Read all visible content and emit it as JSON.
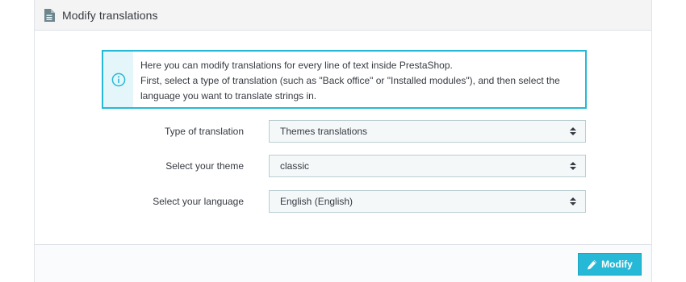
{
  "panel": {
    "title": "Modify translations",
    "title_icon": "document-icon"
  },
  "info": {
    "icon": "info-circle-icon",
    "line1": "Here you can modify translations for every line of text inside PrestaShop.",
    "line2": "First, select a type of translation (such as \"Back office\" or \"Installed modules\"), and then select the",
    "line3": "language you want to translate strings in."
  },
  "form": {
    "type_label": "Type of translation",
    "type_value": "Themes translations",
    "theme_label": "Select your theme",
    "theme_value": "classic",
    "language_label": "Select your language",
    "language_value": "English (English)"
  },
  "footer": {
    "modify_label": "Modify",
    "modify_icon": "pencil-icon"
  },
  "colors": {
    "accent": "#25b9d7",
    "info_bg": "#e4f6f9",
    "text": "#363a41",
    "header_bg": "#f4f4f4",
    "select_bg": "#f5f8f9",
    "select_border": "#bbcdd2"
  }
}
